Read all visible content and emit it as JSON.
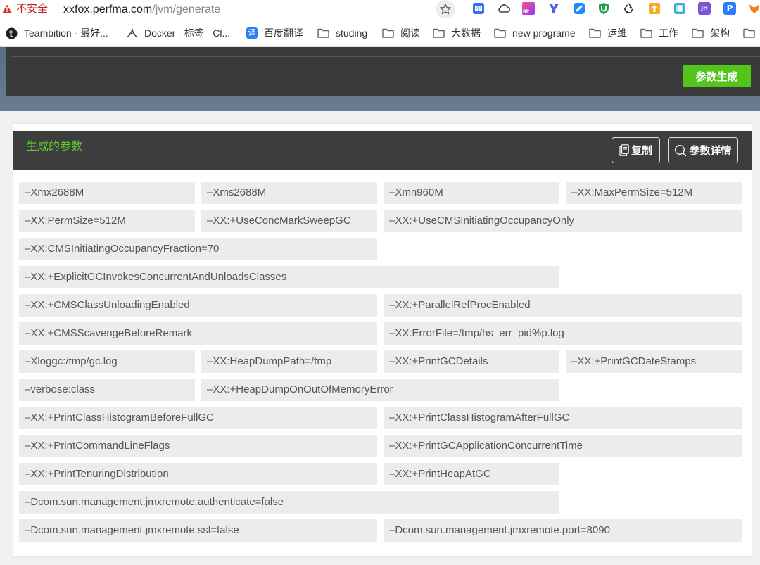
{
  "browser": {
    "security_label": "不安全",
    "url_host": "xxfox.perfma.com",
    "url_path": "/jvm/generate",
    "icons": {
      "warning": "warning-icon",
      "star": "bookmark-star-icon"
    },
    "extensions": [
      {
        "icon": "reader-extension-icon"
      },
      {
        "icon": "cloud-extension-icon"
      },
      {
        "icon": "rp-extension-icon",
        "text": "RP"
      },
      {
        "icon": "y-extension-icon"
      },
      {
        "icon": "blue-extension-icon"
      },
      {
        "icon": "shield-extension-icon"
      },
      {
        "icon": "recycle-extension-icon"
      },
      {
        "icon": "orange-extension-icon"
      },
      {
        "icon": "teal-extension-icon"
      },
      {
        "icon": "jh-extension-icon",
        "text": "JH"
      },
      {
        "icon": "p-extension-icon",
        "text": "P"
      },
      {
        "icon": "fox-extension-icon"
      }
    ]
  },
  "bookmarks": [
    {
      "label": "Teambition · 最好...",
      "icon": "teambition-icon"
    },
    {
      "label": "Docker - 标签 - Cl...",
      "icon": "docker-icon"
    },
    {
      "label": "百度翻译",
      "icon": "baidu-translate-icon",
      "icon_text": "译"
    },
    {
      "label": "studing",
      "icon": "folder-icon"
    },
    {
      "label": "阅读",
      "icon": "folder-icon"
    },
    {
      "label": "大数据",
      "icon": "folder-icon"
    },
    {
      "label": "new programe",
      "icon": "folder-icon"
    },
    {
      "label": "运维",
      "icon": "folder-icon"
    },
    {
      "label": "工作",
      "icon": "folder-icon"
    },
    {
      "label": "架构",
      "icon": "folder-icon"
    },
    {
      "icon": "folder-icon"
    }
  ],
  "generator": {
    "generate_label": "参数生成"
  },
  "result": {
    "title": "生成的参数",
    "copy_label": "复制",
    "copy_icon": "copy-icon",
    "details_label": "参数详情",
    "details_icon": "search-icon",
    "params": [
      "–Xmx2688M",
      "–Xms2688M",
      "–Xmn960M",
      "–XX:MaxPermSize=512M",
      "–XX:PermSize=512M",
      "–XX:+UseConcMarkSweepGC",
      "–XX:+UseCMSInitiatingOccupancyOnly",
      "–XX:CMSInitiatingOccupancyFraction=70",
      "–XX:+ExplicitGCInvokesConcurrentAndUnloadsClasses",
      "–XX:+CMSClassUnloadingEnabled",
      "–XX:+ParallelRefProcEnabled",
      "–XX:+CMSScavengeBeforeRemark",
      "–XX:ErrorFile=/tmp/hs_err_pid%p.log",
      "–Xloggc:/tmp/gc.log",
      "–XX:HeapDumpPath=/tmp",
      "–XX:+PrintGCDetails",
      "–XX:+PrintGCDateStamps",
      "–verbose:class",
      "–XX:+HeapDumpOnOutOfMemoryError",
      "–XX:+PrintClassHistogramBeforeFullGC",
      "–XX:+PrintClassHistogramAfterFullGC",
      "–XX:+PrintCommandLineFlags",
      "–XX:+PrintGCApplicationConcurrentTime",
      "–XX:+PrintTenuringDistribution",
      "–XX:+PrintHeapAtGC",
      "–Dcom.sun.management.jmxremote.authenticate=false",
      "–Dcom.sun.management.jmxremote.ssl=false",
      "–Dcom.sun.management.jmxremote.port=8090"
    ]
  },
  "colors": {
    "accent_green": "#52c41a",
    "title_green": "#5fcf2a",
    "panel_dark": "#3a3a3a",
    "header_dark": "#3d3d3d",
    "insecure_red": "#c5221f",
    "param_bg": "#ececec",
    "band_bluegray": "#62758a"
  }
}
